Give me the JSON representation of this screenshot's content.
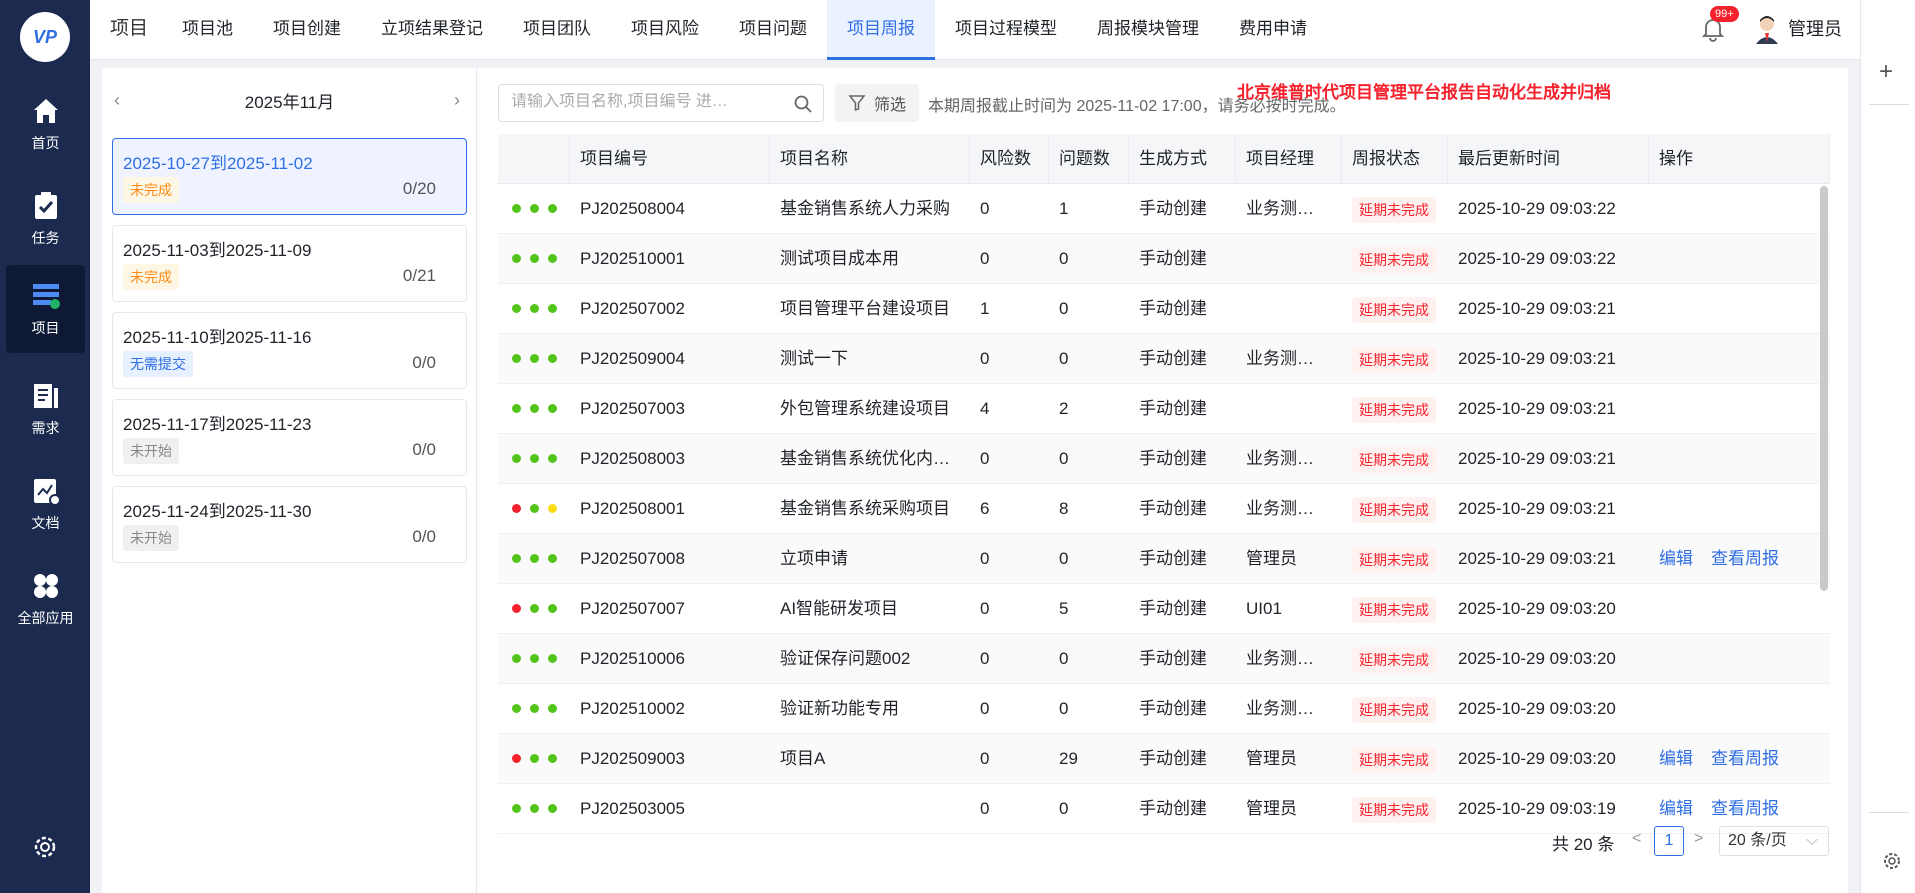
{
  "logo": {
    "text": "VP"
  },
  "sidebar": {
    "items": [
      {
        "label": "首页",
        "icon": "home-icon"
      },
      {
        "label": "任务",
        "icon": "task-icon"
      },
      {
        "label": "项目",
        "icon": "project-icon",
        "active": true
      },
      {
        "label": "需求",
        "icon": "requirement-icon"
      },
      {
        "label": "文档",
        "icon": "document-icon"
      },
      {
        "label": "全部应用",
        "icon": "apps-icon"
      }
    ]
  },
  "topbar": {
    "title": "项目",
    "menu": [
      "项目池",
      "项目创建",
      "立项结果登记",
      "项目团队",
      "项目风险",
      "项目问题",
      "项目周报",
      "项目过程模型",
      "周报模块管理",
      "费用申请"
    ],
    "active_menu": "项目周报",
    "badge": "99+",
    "username": "管理员"
  },
  "calendar": {
    "month": "2025年11月",
    "weeks": [
      {
        "range": "2025-10-27到2025-11-02",
        "tag": "未完成",
        "tag_color": "orange",
        "count": "0/20",
        "active": true
      },
      {
        "range": "2025-11-03到2025-11-09",
        "tag": "未完成",
        "tag_color": "orange",
        "count": "0/21"
      },
      {
        "range": "2025-11-10到2025-11-16",
        "tag": "无需提交",
        "tag_color": "blue",
        "count": "0/0"
      },
      {
        "range": "2025-11-17到2025-11-23",
        "tag": "未开始",
        "tag_color": "grey",
        "count": "0/0"
      },
      {
        "range": "2025-11-24到2025-11-30",
        "tag": "未开始",
        "tag_color": "grey",
        "count": "0/0"
      }
    ]
  },
  "toolbar": {
    "search_placeholder": "请输入项目名称,项目编号 进…",
    "filter_label": "筛选",
    "notice": "本期周报截止时间为 2025-11-02 17:00，请务必按时完成。",
    "overlay": "北京维普时代项目管理平台报告自动化生成并归档"
  },
  "table": {
    "headers": [
      "项目编号",
      "项目名称",
      "风险数",
      "问题数",
      "生成方式",
      "项目经理",
      "周报状态",
      "最后更新时间",
      "操作"
    ],
    "rows": [
      {
        "dots": [
          "#52c41a",
          "#52c41a",
          "#52c41a"
        ],
        "code": "PJ202508004",
        "name": "基金销售系统人力采购",
        "risk": "0",
        "issue": "1",
        "mode": "手动创建",
        "manager": "业务测…",
        "status": "延期未完成",
        "updated": "2025-10-29 09:03:22",
        "ops": []
      },
      {
        "dots": [
          "#52c41a",
          "#52c41a",
          "#52c41a"
        ],
        "code": "PJ202510001",
        "name": "测试项目成本用",
        "risk": "0",
        "issue": "0",
        "mode": "手动创建",
        "manager": "",
        "status": "延期未完成",
        "updated": "2025-10-29 09:03:22",
        "ops": []
      },
      {
        "dots": [
          "#52c41a",
          "#52c41a",
          "#52c41a"
        ],
        "code": "PJ202507002",
        "name": "项目管理平台建设项目",
        "risk": "1",
        "issue": "0",
        "mode": "手动创建",
        "manager": "",
        "status": "延期未完成",
        "updated": "2025-10-29 09:03:21",
        "ops": []
      },
      {
        "dots": [
          "#52c41a",
          "#52c41a",
          "#52c41a"
        ],
        "code": "PJ202509004",
        "name": "测试一下",
        "risk": "0",
        "issue": "0",
        "mode": "手动创建",
        "manager": "业务测…",
        "status": "延期未完成",
        "updated": "2025-10-29 09:03:21",
        "ops": []
      },
      {
        "dots": [
          "#52c41a",
          "#52c41a",
          "#52c41a"
        ],
        "code": "PJ202507003",
        "name": "外包管理系统建设项目",
        "risk": "4",
        "issue": "2",
        "mode": "手动创建",
        "manager": "",
        "status": "延期未完成",
        "updated": "2025-10-29 09:03:21",
        "ops": []
      },
      {
        "dots": [
          "#52c41a",
          "#52c41a",
          "#52c41a"
        ],
        "code": "PJ202508003",
        "name": "基金销售系统优化内…",
        "risk": "0",
        "issue": "0",
        "mode": "手动创建",
        "manager": "业务测…",
        "status": "延期未完成",
        "updated": "2025-10-29 09:03:21",
        "ops": []
      },
      {
        "dots": [
          "#f5222d",
          "#52c41a",
          "#fadb14"
        ],
        "code": "PJ202508001",
        "name": "基金销售系统采购项目",
        "risk": "6",
        "issue": "8",
        "mode": "手动创建",
        "manager": "业务测…",
        "status": "延期未完成",
        "updated": "2025-10-29 09:03:21",
        "ops": []
      },
      {
        "dots": [
          "#52c41a",
          "#52c41a",
          "#52c41a"
        ],
        "code": "PJ202507008",
        "name": "立项申请",
        "risk": "0",
        "issue": "0",
        "mode": "手动创建",
        "manager": "管理员",
        "status": "延期未完成",
        "updated": "2025-10-29 09:03:21",
        "ops": [
          "编辑",
          "查看周报"
        ]
      },
      {
        "dots": [
          "#f5222d",
          "#52c41a",
          "#52c41a"
        ],
        "code": "PJ202507007",
        "name": "AI智能研发项目",
        "risk": "0",
        "issue": "5",
        "mode": "手动创建",
        "manager": "UI01",
        "status": "延期未完成",
        "updated": "2025-10-29 09:03:20",
        "ops": []
      },
      {
        "dots": [
          "#52c41a",
          "#52c41a",
          "#52c41a"
        ],
        "code": "PJ202510006",
        "name": "验证保存问题002",
        "risk": "0",
        "issue": "0",
        "mode": "手动创建",
        "manager": "业务测…",
        "status": "延期未完成",
        "updated": "2025-10-29 09:03:20",
        "ops": []
      },
      {
        "dots": [
          "#52c41a",
          "#52c41a",
          "#52c41a"
        ],
        "code": "PJ202510002",
        "name": "验证新功能专用",
        "risk": "0",
        "issue": "0",
        "mode": "手动创建",
        "manager": "业务测…",
        "status": "延期未完成",
        "updated": "2025-10-29 09:03:20",
        "ops": []
      },
      {
        "dots": [
          "#f5222d",
          "#52c41a",
          "#52c41a"
        ],
        "code": "PJ202509003",
        "name": "项目A",
        "risk": "0",
        "issue": "29",
        "mode": "手动创建",
        "manager": "管理员",
        "status": "延期未完成",
        "updated": "2025-10-29 09:03:20",
        "ops": [
          "编辑",
          "查看周报"
        ]
      },
      {
        "dots": [
          "#52c41a",
          "#52c41a",
          "#52c41a"
        ],
        "code": "PJ202503005",
        "name": "",
        "risk": "0",
        "issue": "0",
        "mode": "手动创建",
        "manager": "管理员",
        "status": "延期未完成",
        "updated": "2025-10-29 09:03:19",
        "ops": [
          "编辑",
          "查看周报"
        ]
      }
    ]
  },
  "pagination": {
    "total": "共 20 条",
    "current": "1",
    "page_size": "20 条/页"
  }
}
